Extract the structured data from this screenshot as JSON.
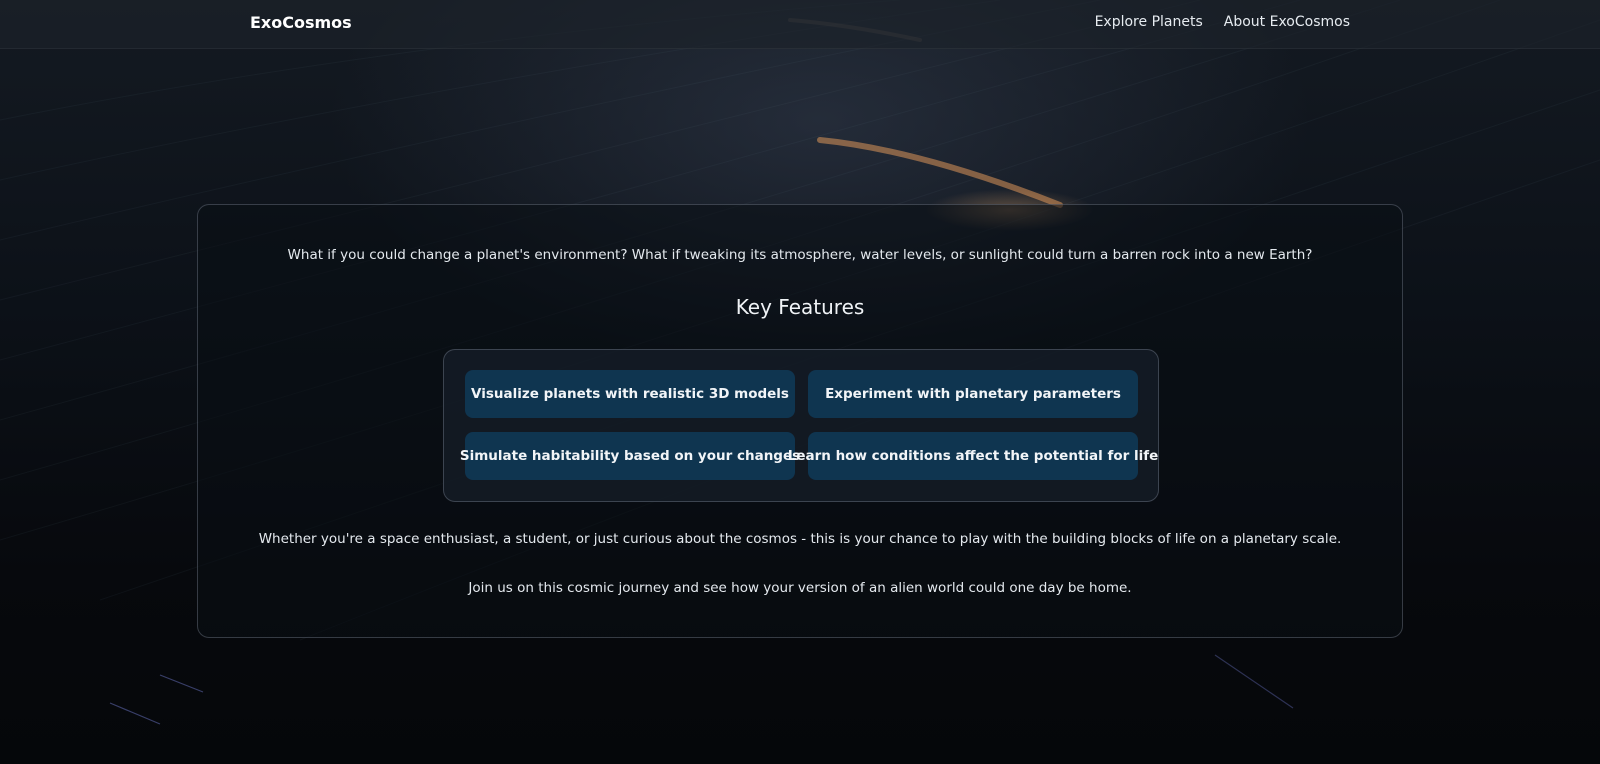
{
  "app": {
    "brand": "ExoCosmos"
  },
  "nav": {
    "links": [
      {
        "label": "Explore Planets"
      },
      {
        "label": "About ExoCosmos"
      }
    ]
  },
  "main": {
    "intro": "What if you could change a planet's environment? What if tweaking its atmosphere, water levels, or sunlight could turn a barren rock into a new Earth?",
    "features_title": "Key Features",
    "features": [
      {
        "label": "Visualize planets with realistic 3D models"
      },
      {
        "label": "Experiment with planetary parameters"
      },
      {
        "label": "Simulate habitability based on your changes"
      },
      {
        "label": "Learn how conditions affect the potential for life"
      }
    ],
    "outro_1": "Whether you're a space enthusiast, a student, or just curious about the cosmos - this is your chance to play with the building blocks of life on a planetary scale.",
    "outro_2": "Join us on this cosmic journey and see how your version of an alien world could one day be home."
  },
  "colors": {
    "feature_button_bg": "#0f3550",
    "background_dark": "#07090d",
    "navbar_bg": "#1c222a"
  }
}
